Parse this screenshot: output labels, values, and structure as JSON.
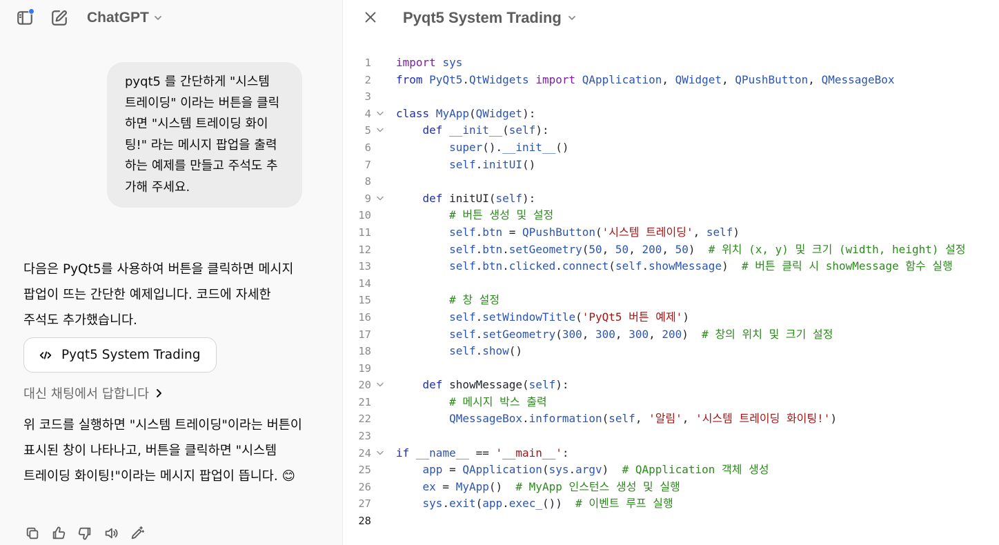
{
  "app": {
    "model_label": "ChatGPT",
    "icons": {
      "sidebar": "sidebar-toggle-icon",
      "new_chat": "new-chat-icon",
      "chevron": "chevron-down-icon",
      "close": "close-icon"
    },
    "accent_dot_color": "#3478f6"
  },
  "conversation": {
    "user_message": "pyqt5 를 간단하게 \"시스템 트레이딩\" 이라는 버튼을 클릭하면 \"시스템 트레이딩 화이팅!\" 라는 메시지 팝업을 출력하는 예제를 만들고 주석도 추가해 주세요.",
    "assistant_intro": "다음은 PyQt5를 사용하여 버튼을 클릭하면 메시지 팝업이 뜨는 간단한 예제입니다. 코드에 자세한 주석도 추가했습니다.",
    "canvas_card_label": "Pyqt5 System Trading",
    "answer_in_chat_label": "대신 채팅에서 답합니다",
    "assistant_outro": "위 코드를 실행하면 \"시스템 트레이딩\"이라는 버튼이 표시된 창이 나타나고, 버튼을 클릭하면 \"시스템 트레이딩 화이팅!\"이라는 메시지 팝업이 뜹니다. 😊",
    "actions": [
      "copy-icon",
      "thumbs-up-icon",
      "thumbs-down-icon",
      "read-aloud-icon",
      "edit-in-canvas-icon"
    ]
  },
  "editor": {
    "title": "Pyqt5 System Trading",
    "active_line": 28,
    "lines": [
      {
        "n": "1",
        "fold": false,
        "segs": [
          [
            "kw",
            "import"
          ],
          [
            "plain",
            " "
          ],
          [
            "ident",
            "sys"
          ]
        ]
      },
      {
        "n": "2",
        "fold": false,
        "segs": [
          [
            "kb",
            "from"
          ],
          [
            "plain",
            " "
          ],
          [
            "ident",
            "PyQt5"
          ],
          [
            "plain",
            "."
          ],
          [
            "ident",
            "QtWidgets"
          ],
          [
            "plain",
            " "
          ],
          [
            "kw",
            "import"
          ],
          [
            "plain",
            " "
          ],
          [
            "ident",
            "QApplication"
          ],
          [
            "plain",
            ", "
          ],
          [
            "ident",
            "QWidget"
          ],
          [
            "plain",
            ", "
          ],
          [
            "ident",
            "QPushButton"
          ],
          [
            "plain",
            ", "
          ],
          [
            "ident",
            "QMessageBox"
          ]
        ]
      },
      {
        "n": "3",
        "fold": false,
        "segs": []
      },
      {
        "n": "4",
        "fold": true,
        "segs": [
          [
            "kb",
            "class"
          ],
          [
            "plain",
            " "
          ],
          [
            "ident",
            "MyApp"
          ],
          [
            "plain",
            "("
          ],
          [
            "ident",
            "QWidget"
          ],
          [
            "plain",
            "):"
          ]
        ]
      },
      {
        "n": "5",
        "fold": true,
        "segs": [
          [
            "plain",
            "    "
          ],
          [
            "kb",
            "def"
          ],
          [
            "plain",
            " "
          ],
          [
            "ident",
            "__init__"
          ],
          [
            "plain",
            "("
          ],
          [
            "ident",
            "self"
          ],
          [
            "plain",
            "):"
          ]
        ]
      },
      {
        "n": "6",
        "fold": false,
        "segs": [
          [
            "plain",
            "        "
          ],
          [
            "ident",
            "super"
          ],
          [
            "plain",
            "()."
          ],
          [
            "ident",
            "__init__"
          ],
          [
            "plain",
            "()"
          ]
        ]
      },
      {
        "n": "7",
        "fold": false,
        "segs": [
          [
            "plain",
            "        "
          ],
          [
            "ident",
            "self"
          ],
          [
            "plain",
            "."
          ],
          [
            "ident",
            "initUI"
          ],
          [
            "plain",
            "()"
          ]
        ]
      },
      {
        "n": "8",
        "fold": false,
        "segs": []
      },
      {
        "n": "9",
        "fold": true,
        "segs": [
          [
            "plain",
            "    "
          ],
          [
            "kb",
            "def"
          ],
          [
            "plain",
            " initUI("
          ],
          [
            "ident",
            "self"
          ],
          [
            "plain",
            "):"
          ]
        ]
      },
      {
        "n": "10",
        "fold": false,
        "segs": [
          [
            "plain",
            "        "
          ],
          [
            "cm",
            "# 버튼 생성 및 설정"
          ]
        ]
      },
      {
        "n": "11",
        "fold": false,
        "segs": [
          [
            "plain",
            "        "
          ],
          [
            "ident",
            "self"
          ],
          [
            "plain",
            "."
          ],
          [
            "ident",
            "btn"
          ],
          [
            "plain",
            " = "
          ],
          [
            "ident",
            "QPushButton"
          ],
          [
            "plain",
            "("
          ],
          [
            "str",
            "'시스템 트레이딩'"
          ],
          [
            "plain",
            ", "
          ],
          [
            "ident",
            "self"
          ],
          [
            "plain",
            ")"
          ]
        ]
      },
      {
        "n": "12",
        "fold": false,
        "segs": [
          [
            "plain",
            "        "
          ],
          [
            "ident",
            "self"
          ],
          [
            "plain",
            "."
          ],
          [
            "ident",
            "btn"
          ],
          [
            "plain",
            "."
          ],
          [
            "ident",
            "setGeometry"
          ],
          [
            "plain",
            "("
          ],
          [
            "num",
            "50"
          ],
          [
            "plain",
            ", "
          ],
          [
            "num",
            "50"
          ],
          [
            "plain",
            ", "
          ],
          [
            "num",
            "200"
          ],
          [
            "plain",
            ", "
          ],
          [
            "num",
            "50"
          ],
          [
            "plain",
            ")  "
          ],
          [
            "cm",
            "# 위치 (x, y) 및 크기 (width, height) 설정"
          ]
        ]
      },
      {
        "n": "13",
        "fold": false,
        "segs": [
          [
            "plain",
            "        "
          ],
          [
            "ident",
            "self"
          ],
          [
            "plain",
            "."
          ],
          [
            "ident",
            "btn"
          ],
          [
            "plain",
            "."
          ],
          [
            "ident",
            "clicked"
          ],
          [
            "plain",
            "."
          ],
          [
            "ident",
            "connect"
          ],
          [
            "plain",
            "("
          ],
          [
            "ident",
            "self"
          ],
          [
            "plain",
            "."
          ],
          [
            "ident",
            "showMessage"
          ],
          [
            "plain",
            ")  "
          ],
          [
            "cm",
            "# 버튼 클릭 시 showMessage 함수 실행"
          ]
        ]
      },
      {
        "n": "14",
        "fold": false,
        "segs": []
      },
      {
        "n": "15",
        "fold": false,
        "segs": [
          [
            "plain",
            "        "
          ],
          [
            "cm",
            "# 창 설정"
          ]
        ]
      },
      {
        "n": "16",
        "fold": false,
        "segs": [
          [
            "plain",
            "        "
          ],
          [
            "ident",
            "self"
          ],
          [
            "plain",
            "."
          ],
          [
            "ident",
            "setWindowTitle"
          ],
          [
            "plain",
            "("
          ],
          [
            "str",
            "'PyQt5 버튼 예제'"
          ],
          [
            "plain",
            ")"
          ]
        ]
      },
      {
        "n": "17",
        "fold": false,
        "segs": [
          [
            "plain",
            "        "
          ],
          [
            "ident",
            "self"
          ],
          [
            "plain",
            "."
          ],
          [
            "ident",
            "setGeometry"
          ],
          [
            "plain",
            "("
          ],
          [
            "num",
            "300"
          ],
          [
            "plain",
            ", "
          ],
          [
            "num",
            "300"
          ],
          [
            "plain",
            ", "
          ],
          [
            "num",
            "300"
          ],
          [
            "plain",
            ", "
          ],
          [
            "num",
            "200"
          ],
          [
            "plain",
            ")  "
          ],
          [
            "cm",
            "# 창의 위치 및 크기 설정"
          ]
        ]
      },
      {
        "n": "18",
        "fold": false,
        "segs": [
          [
            "plain",
            "        "
          ],
          [
            "ident",
            "self"
          ],
          [
            "plain",
            "."
          ],
          [
            "ident",
            "show"
          ],
          [
            "plain",
            "()"
          ]
        ]
      },
      {
        "n": "19",
        "fold": false,
        "segs": []
      },
      {
        "n": "20",
        "fold": true,
        "segs": [
          [
            "plain",
            "    "
          ],
          [
            "kb",
            "def"
          ],
          [
            "plain",
            " showMessage("
          ],
          [
            "ident",
            "self"
          ],
          [
            "plain",
            "):"
          ]
        ]
      },
      {
        "n": "21",
        "fold": false,
        "segs": [
          [
            "plain",
            "        "
          ],
          [
            "cm",
            "# 메시지 박스 출력"
          ]
        ]
      },
      {
        "n": "22",
        "fold": false,
        "segs": [
          [
            "plain",
            "        "
          ],
          [
            "ident",
            "QMessageBox"
          ],
          [
            "plain",
            "."
          ],
          [
            "ident",
            "information"
          ],
          [
            "plain",
            "("
          ],
          [
            "ident",
            "self"
          ],
          [
            "plain",
            ", "
          ],
          [
            "str",
            "'알림'"
          ],
          [
            "plain",
            ", "
          ],
          [
            "str",
            "'시스템 트레이딩 화이팅!'"
          ],
          [
            "plain",
            ")"
          ]
        ]
      },
      {
        "n": "23",
        "fold": false,
        "segs": []
      },
      {
        "n": "24",
        "fold": true,
        "segs": [
          [
            "kb",
            "if"
          ],
          [
            "plain",
            " "
          ],
          [
            "ident",
            "__name__"
          ],
          [
            "plain",
            " == "
          ],
          [
            "str",
            "'__main__'"
          ],
          [
            "plain",
            ":"
          ]
        ]
      },
      {
        "n": "25",
        "fold": false,
        "segs": [
          [
            "plain",
            "    "
          ],
          [
            "ident",
            "app"
          ],
          [
            "plain",
            " = "
          ],
          [
            "ident",
            "QApplication"
          ],
          [
            "plain",
            "("
          ],
          [
            "ident",
            "sys"
          ],
          [
            "plain",
            "."
          ],
          [
            "ident",
            "argv"
          ],
          [
            "plain",
            ")  "
          ],
          [
            "cm",
            "# QApplication 객체 생성"
          ]
        ]
      },
      {
        "n": "26",
        "fold": false,
        "segs": [
          [
            "plain",
            "    "
          ],
          [
            "ident",
            "ex"
          ],
          [
            "plain",
            " = "
          ],
          [
            "ident",
            "MyApp"
          ],
          [
            "plain",
            "()  "
          ],
          [
            "cm",
            "# MyApp 인스턴스 생성 및 실행"
          ]
        ]
      },
      {
        "n": "27",
        "fold": false,
        "segs": [
          [
            "plain",
            "    "
          ],
          [
            "ident",
            "sys"
          ],
          [
            "plain",
            "."
          ],
          [
            "ident",
            "exit"
          ],
          [
            "plain",
            "("
          ],
          [
            "ident",
            "app"
          ],
          [
            "plain",
            "."
          ],
          [
            "ident",
            "exec_"
          ],
          [
            "plain",
            "())  "
          ],
          [
            "cm",
            "# 이벤트 루프 실행"
          ]
        ]
      },
      {
        "n": "28",
        "fold": false,
        "segs": []
      }
    ]
  }
}
